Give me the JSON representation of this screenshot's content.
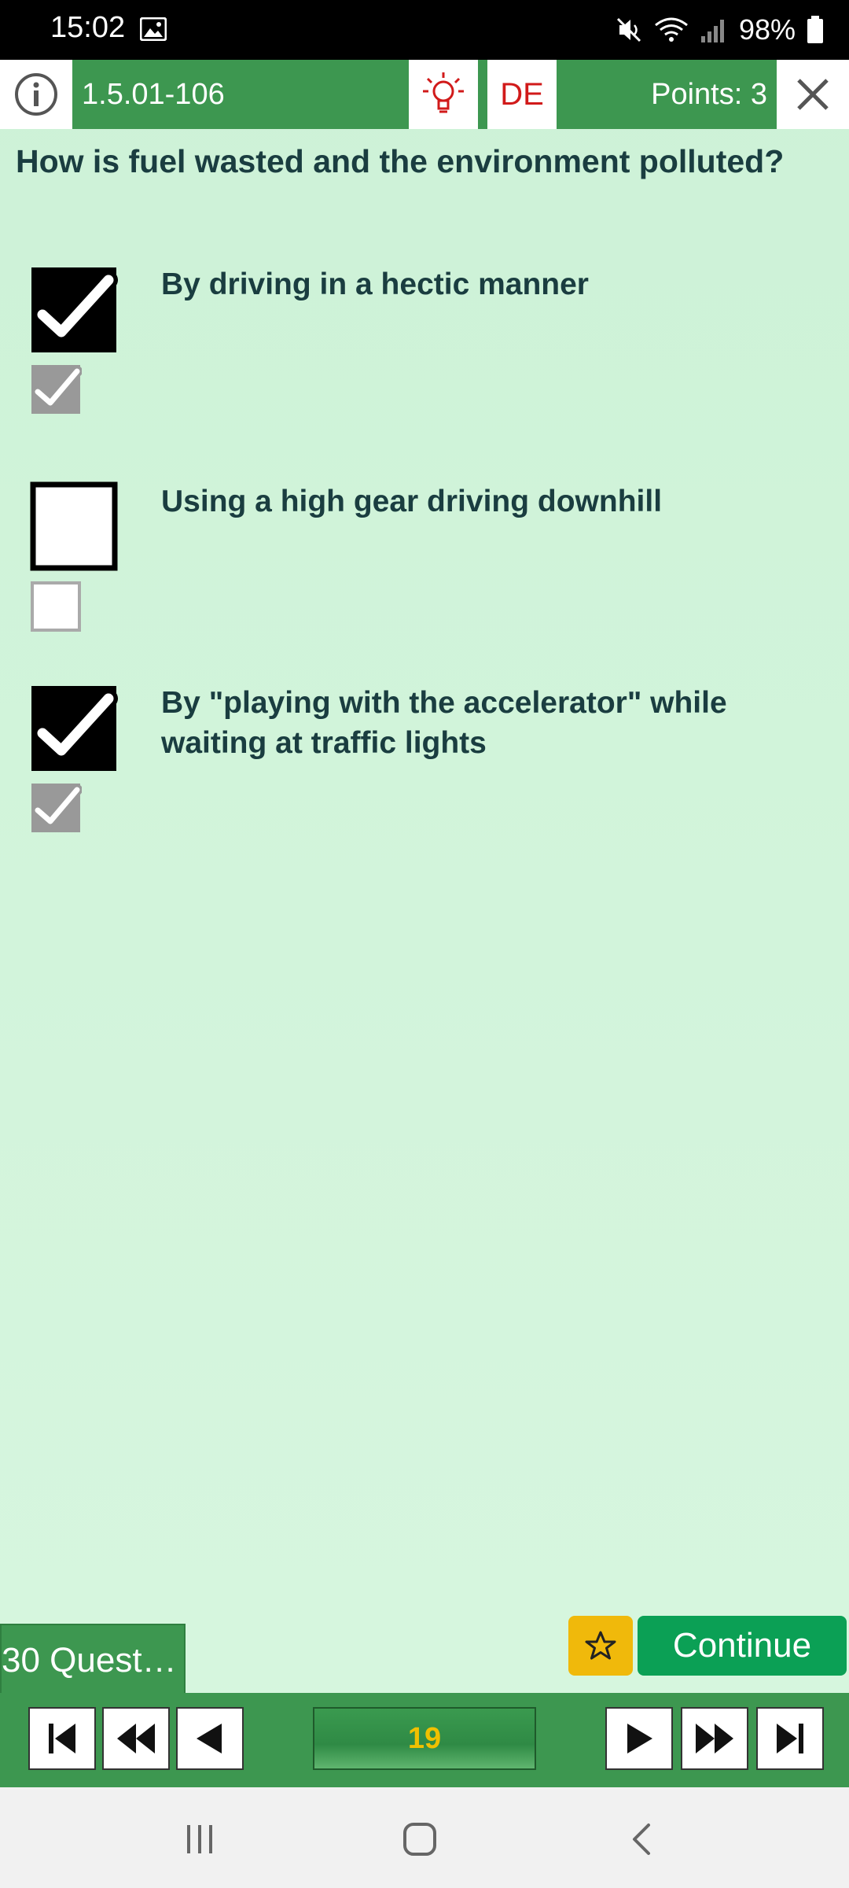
{
  "status": {
    "time": "15:02",
    "battery": "98%"
  },
  "header": {
    "question_id": "1.5.01-106",
    "language": "DE",
    "points": "Points: 3"
  },
  "question": "How is fuel wasted and the environment polluted?",
  "answers": [
    {
      "text": "By driving in a hectic manner",
      "user_checked": true,
      "correct": true
    },
    {
      "text": "Using a high gear driving downhill",
      "user_checked": false,
      "correct": false
    },
    {
      "text": "By \"playing with the accelerator\" while waiting at traffic lights",
      "user_checked": true,
      "correct": true
    }
  ],
  "footer": {
    "tab_label": "30 Questi…",
    "continue_label": "Continue",
    "counter": "19"
  },
  "colors": {
    "bar_green": "#3d9750",
    "content_bg": "#d0f3d9",
    "continue_green": "#0ba055",
    "star_yellow": "#f0b90b",
    "counter_text": "#f0c000"
  },
  "icons": [
    "info-icon",
    "lightbulb-icon",
    "close-icon",
    "star-icon",
    "first-icon",
    "rewind-icon",
    "prev-icon",
    "next-icon",
    "fast-forward-icon",
    "last-icon"
  ]
}
